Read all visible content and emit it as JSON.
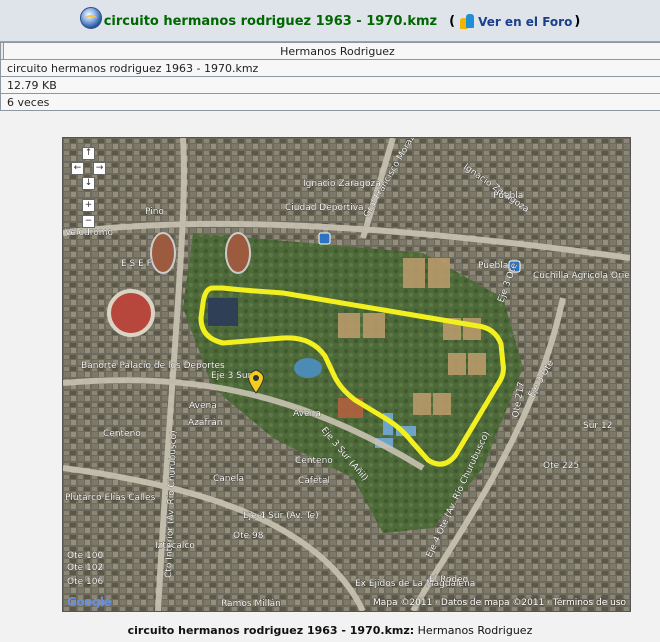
{
  "header": {
    "title": "circuito hermanos rodriguez 1963 - 1970.kmz",
    "forum_open": "(",
    "forum_link": "Ver en el Foro",
    "forum_close": ")"
  },
  "info": {
    "author": "Hermanos Rodriguez",
    "filename": "circuito hermanos rodriguez 1963 - 1970.kmz",
    "size": "12.79 KB",
    "views": "6 veces"
  },
  "map": {
    "labels": [
      "Pino",
      "Velodromo",
      "E S E F",
      "Ignacio Zaragoza",
      "Ciudad Deportiva",
      "Gral Francisco Morazán (Av.)",
      "Ignacio Zaragoza",
      "Puebla",
      "Puebla",
      "Cuchilla Agrícola Oriental",
      "Eje 3 Ote",
      "Banorte Palacio de los Deportes",
      "Eje 3 Sur",
      "Avena",
      "Avena",
      "Azafrán",
      "Centeno",
      "Centeno",
      "Canela",
      "Cafetal",
      "Eje 3 Sur (Añil)",
      "Plutarco Elías Calles",
      "Eje 4 Sur (Av. Te)",
      "Iztacalco",
      "Ote 98",
      "Ote 100",
      "Ote 102",
      "Ote 106",
      "Ex Ejidos de La Magdalena",
      "El Rodeo",
      "Ramos Millán",
      "Sur 12",
      "Ote 225",
      "Eje 4 Ote (Av. Río Churubusco)",
      "Eje 3 Ote",
      "Ote 217",
      "Cto Interior (Av. Río Churubusco)"
    ],
    "copyright": "Mapa ©2011 · Datos de mapa ©2011 · Términos de uso",
    "logo": "Google",
    "nav": {
      "up": "↑",
      "left": "←",
      "right": "→",
      "down": "↓",
      "zoom_in": "+",
      "zoom_out": "−"
    }
  },
  "caption": {
    "bold": "circuito hermanos rodriguez 1963 - 1970.kmz:",
    "rest": " Hermanos Rodriguez"
  },
  "colors": {
    "title": "#006600",
    "link": "#1a3f8c",
    "track": "#f3f020",
    "header_bg": "#dfe3ea"
  }
}
